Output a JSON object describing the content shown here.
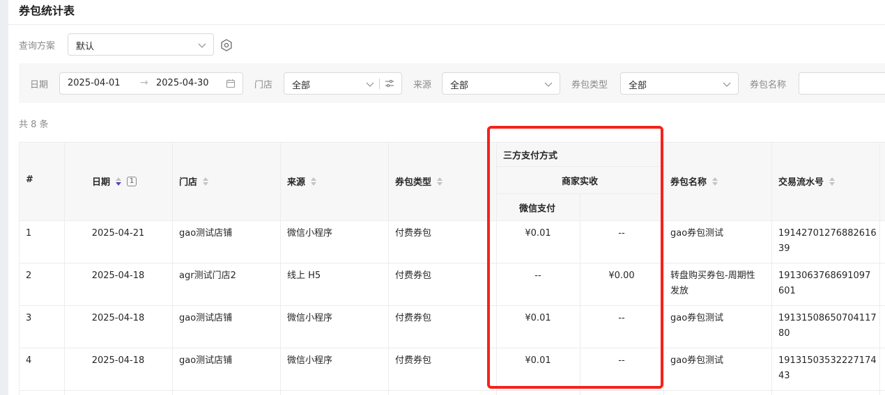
{
  "page": {
    "title": "券包统计表"
  },
  "scheme": {
    "label": "查询方案",
    "value": "默认"
  },
  "filters": {
    "date": {
      "label": "日期",
      "start": "2025-04-01",
      "end": "2025-04-30"
    },
    "store": {
      "label": "门店",
      "value": "全部"
    },
    "source": {
      "label": "来源",
      "value": "全部"
    },
    "package_type": {
      "label": "券包类型",
      "value": "全部"
    },
    "package_name": {
      "label": "券包名称",
      "value": ""
    }
  },
  "total_text": "共 8 条",
  "table": {
    "headers": {
      "index": "#",
      "date": "日期",
      "date_sort_order": "1",
      "store": "门店",
      "source": "来源",
      "type": "券包类型",
      "third_party_group": "三方支付方式",
      "merchant_group": "商家实收",
      "wechat_pay": "微信支付",
      "name": "券包名称",
      "serial": "交易流水号"
    },
    "rows": [
      {
        "index": "1",
        "date": "2025-04-21",
        "store": "gao测试店铺",
        "source": "微信小程序",
        "type": "付费券包",
        "wechat": "¥0.01",
        "other": "--",
        "name_l1": "gao券包测试",
        "name_l2": "",
        "serial_l1": "19142701276882616",
        "serial_l2": "39"
      },
      {
        "index": "2",
        "date": "2025-04-18",
        "store": "agr测试门店2",
        "source": "线上 H5",
        "type": "付费券包",
        "wechat": "--",
        "other": "¥0.00",
        "name_l1": "转盘购买券包-周期性",
        "name_l2": "发放",
        "serial_l1": "1913063768691097",
        "serial_l2": "601"
      },
      {
        "index": "3",
        "date": "2025-04-18",
        "store": "gao测试店铺",
        "source": "微信小程序",
        "type": "付费券包",
        "wechat": "¥0.01",
        "other": "--",
        "name_l1": "gao券包测试",
        "name_l2": "",
        "serial_l1": "19131508650704117",
        "serial_l2": "80"
      },
      {
        "index": "4",
        "date": "2025-04-18",
        "store": "gao测试店铺",
        "source": "微信小程序",
        "type": "付费券包",
        "wechat": "¥0.01",
        "other": "--",
        "name_l1": "gao券包测试",
        "name_l2": "",
        "serial_l1": "19131503532227174",
        "serial_l2": "43"
      }
    ]
  },
  "colors": {
    "highlight": "#f5221b",
    "sort_active": "#4f46b8"
  }
}
